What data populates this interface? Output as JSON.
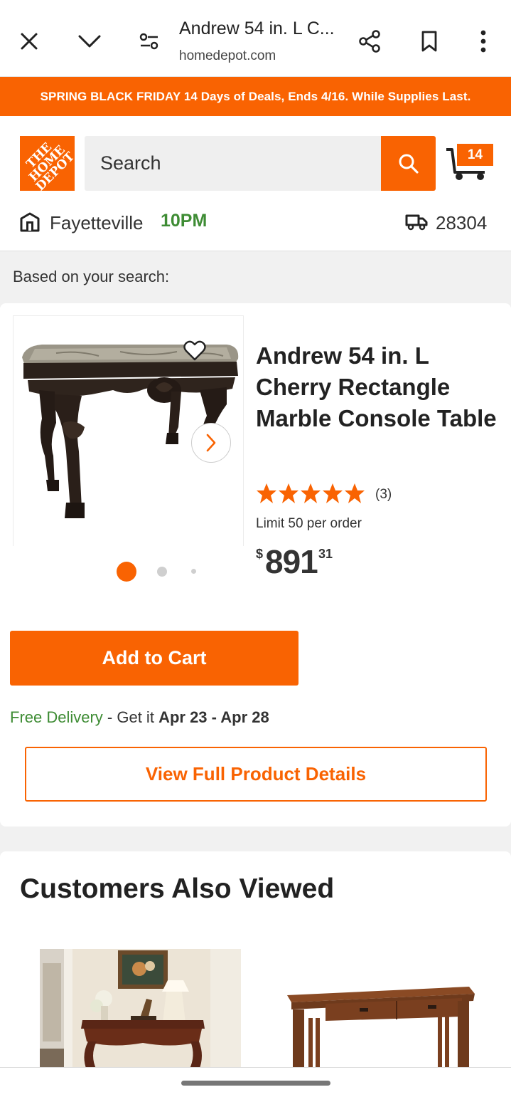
{
  "browser": {
    "page_title": "Andrew 54 in. L C...",
    "url": "homedepot.com",
    "icons": [
      "close-icon",
      "chevron-down-icon",
      "site-settings-icon",
      "share-icon",
      "bookmark-icon",
      "more-icon"
    ]
  },
  "promo": {
    "text": "SPRING BLACK FRIDAY 14 Days of Deals, Ends 4/16. While Supplies Last."
  },
  "header": {
    "logo_text": "THE HOME DEPOT",
    "search_placeholder": "Search",
    "cart_count": "14",
    "store_name": "Fayetteville",
    "store_hours": "10PM",
    "zip": "28304"
  },
  "search_result": {
    "heading": "Based on your search:",
    "product": {
      "title": "Andrew 54 in. L Cherry Rectangle Marble Console Table",
      "rating": 5,
      "review_count": "(3)",
      "limit": "Limit 50 per order",
      "price_currency": "$",
      "price_dollars": "891",
      "price_cents": "31",
      "image_dots": 3,
      "active_dot": 0
    },
    "add_to_cart_label": "Add to Cart",
    "delivery_free": "Free Delivery",
    "delivery_mid": " - Get it ",
    "delivery_dates": "Apr 23 - Apr 28",
    "view_details_label": "View Full Product Details"
  },
  "also_viewed": {
    "heading": "Customers Also Viewed"
  },
  "colors": {
    "brand_orange": "#f96302",
    "green": "#3e8c34"
  }
}
